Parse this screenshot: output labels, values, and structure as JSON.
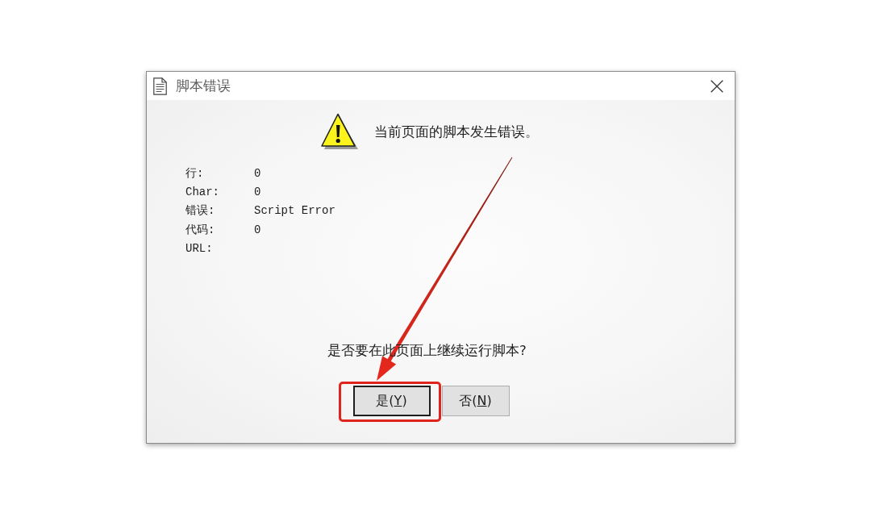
{
  "window": {
    "title": "脚本错误"
  },
  "message": "当前页面的脚本发生错误。",
  "details": [
    {
      "label": "行:",
      "value": "0"
    },
    {
      "label": "Char:",
      "value": "0"
    },
    {
      "label": "错误:",
      "value": "Script Error"
    },
    {
      "label": "代码:",
      "value": "0"
    },
    {
      "label": "URL:"
    }
  ],
  "question": "是否要在此页面上继续运行脚本?",
  "buttons": [
    {
      "prefix": "是(",
      "access_key": "Y",
      "suffix": ")",
      "default": true,
      "highlighted": true
    },
    {
      "prefix": "否(",
      "access_key": "N",
      "suffix": ")",
      "default": false,
      "highlighted": false
    }
  ]
}
